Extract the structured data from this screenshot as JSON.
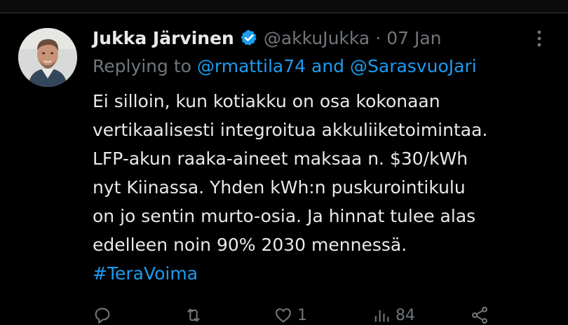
{
  "tweet": {
    "author": {
      "name": "Jukka Järvinen",
      "handle": "@akkuJukka",
      "separator": "·",
      "date": "07 Jan",
      "verified": true
    },
    "reply": {
      "prefix": "Replying to",
      "mention_1": "@rmattila74",
      "conjunction": "and",
      "mention_2": "@SarasvuoJari"
    },
    "body_lines": [
      "Ei silloin, kun kotiakku on osa kokonaan",
      "vertikaalisesti integroitua akkuliiketoimintaa.",
      "LFP-akun raaka-aineet maksaa n. $30/kWh",
      "nyt Kiinassa. Yhden kWh:n puskurointikulu",
      "on jo sentin murto-osia. Ja hinnat tulee alas",
      "edelleen noin 90% 2030 mennessä."
    ],
    "hashtag": "#TeraVoima",
    "actions": {
      "like_count": "1",
      "views_count": "84"
    }
  },
  "colors": {
    "background": "#000000",
    "text": "#e7e9ea",
    "muted": "#71767b",
    "accent": "#1d9bf0"
  },
  "icons": [
    "avatar-photo",
    "verified-badge-icon",
    "more-icon",
    "reply-icon",
    "retweet-icon",
    "like-icon",
    "views-icon",
    "share-icon"
  ]
}
